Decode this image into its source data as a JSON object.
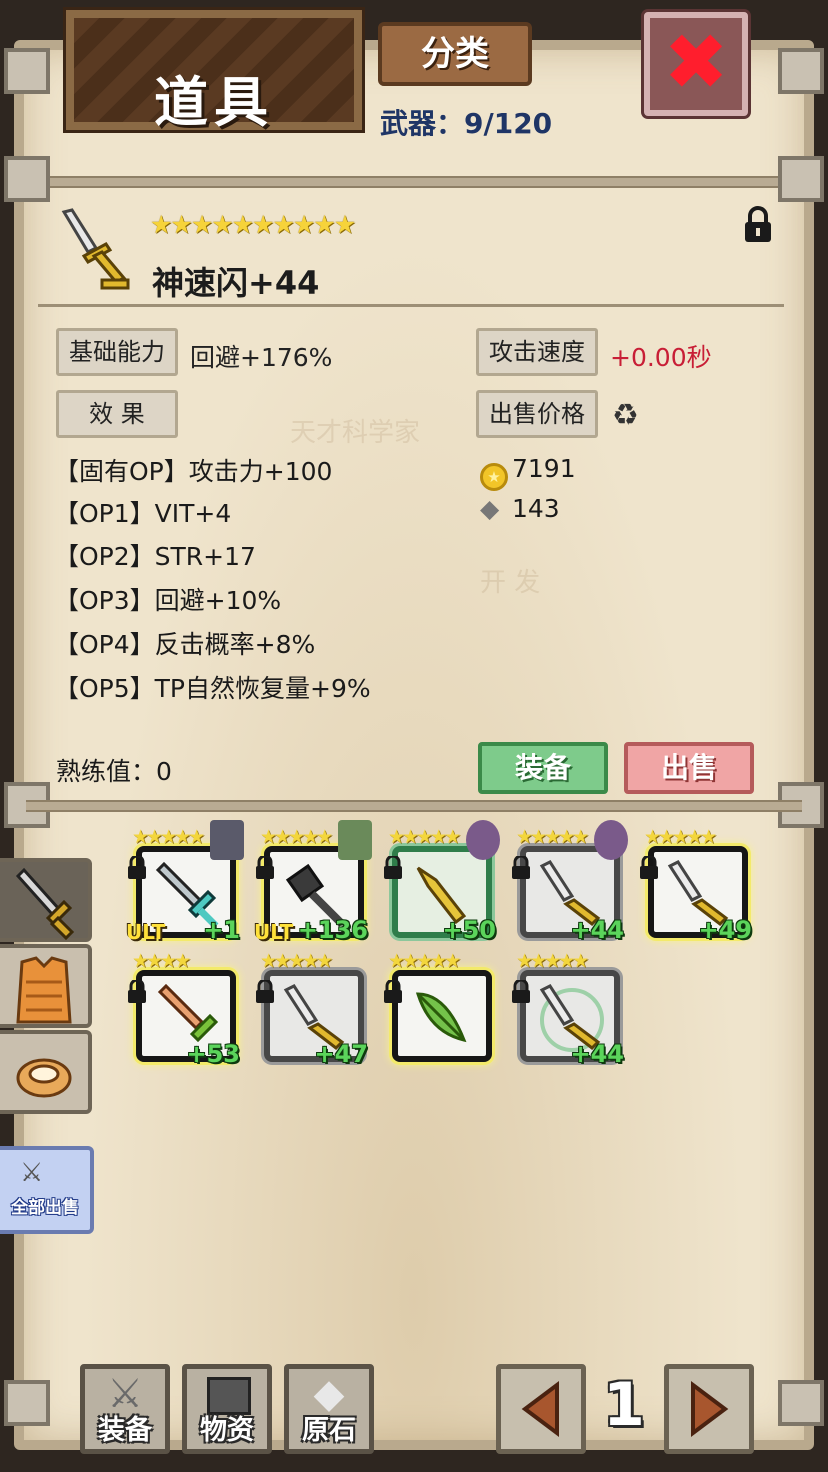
{
  "header": {
    "title": "道具",
    "category_label": "分类",
    "weapon_count": "武器：9/120",
    "close_icon": "close-x-icon"
  },
  "item": {
    "stars": "★★★★★★★★★★",
    "name": "神速闪+44",
    "base_ability_label": "基础能力",
    "base_ability_value": "回避+176%",
    "attack_speed_label": "攻击速度",
    "attack_speed_value": "+0.00秒",
    "effect_label": "效 果",
    "sell_price_label": "出售价格",
    "effects": [
      "【固有OP】攻击力+100",
      "【OP1】VIT+4",
      "【OP2】STR+17",
      "【OP3】回避+10%",
      "【OP4】反击概率+8%",
      "【OP5】TP自然恢复量+9%"
    ],
    "gold_price": "7191",
    "ore_price": "143",
    "proficiency": "熟练值：0",
    "equip_label": "装备",
    "sell_label": "出售"
  },
  "inventory": {
    "slots": [
      {
        "stars": "★★★★★",
        "level": "+1",
        "ult": "ULT",
        "frame": "gold"
      },
      {
        "stars": "★★★★★",
        "level": "+136",
        "ult": "ULT",
        "frame": "gold"
      },
      {
        "stars": "★★★★★",
        "level": "+50",
        "ult": "",
        "frame": "green"
      },
      {
        "stars": "★★★★★",
        "level": "+44",
        "ult": "",
        "frame": "gray"
      },
      {
        "stars": "★★★★★",
        "level": "+49",
        "ult": "",
        "frame": "gold"
      },
      {
        "stars": "★★★★",
        "level": "+53",
        "ult": "",
        "frame": "gold"
      },
      {
        "stars": "★★★★★",
        "level": "+47",
        "ult": "",
        "frame": "gray"
      },
      {
        "stars": "★★★★★",
        "level": "+",
        "ult": "",
        "frame": "gold"
      },
      {
        "stars": "★★★★★",
        "level": "+44",
        "ult": "",
        "frame": "gray"
      }
    ]
  },
  "side": {
    "sell_all_label": "全部出售"
  },
  "bottom": {
    "equip_label": "装备",
    "materials_label": "物资",
    "ore_label": "原石",
    "page_number": "1"
  },
  "colors": {
    "parchment": "#efe4cc",
    "accent_red": "#c81e36",
    "level_green": "#5bd45b",
    "star_gold": "#f6d33a"
  }
}
